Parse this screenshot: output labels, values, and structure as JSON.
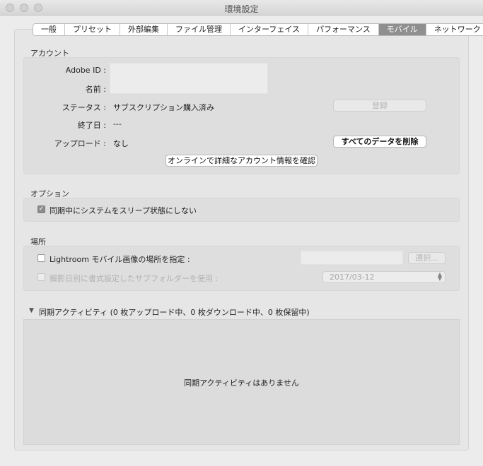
{
  "window": {
    "title": "環境設定"
  },
  "tabs": [
    {
      "label": "一般"
    },
    {
      "label": "プリセット"
    },
    {
      "label": "外部編集"
    },
    {
      "label": "ファイル管理"
    },
    {
      "label": "インターフェイス"
    },
    {
      "label": "パフォーマンス"
    },
    {
      "label": "モバイル"
    },
    {
      "label": "ネットワーク"
    }
  ],
  "account": {
    "section_label": "アカウント",
    "adobe_id_label": "Adobe ID :",
    "name_label": "名前 :",
    "status_label": "ステータス :",
    "status_value": "サブスクリプション購入済み",
    "register_button": "登録",
    "end_date_label": "終了日 :",
    "end_date_value": "---",
    "upload_label": "アップロード :",
    "upload_value": "なし",
    "delete_all_button": "すべてのデータを削除",
    "online_button": "オンラインで詳細なアカウント情報を確認"
  },
  "options": {
    "section_label": "オプション",
    "prevent_sleep_label": "同期中にシステムをスリープ状態にしない"
  },
  "location": {
    "section_label": "場所",
    "specify_label": "Lightroom モバイル画像の場所を指定 :",
    "choose_button": "選択...",
    "subfolder_label": "撮影日別に書式設定したサブフォルダーを使用 :",
    "date_format_value": "2017/03-12"
  },
  "activity": {
    "title": "同期アクティビティ (0 枚アップロード中、0 枚ダウンロード中、0 枚保留中)",
    "empty_message": "同期アクティビティはありません"
  }
}
